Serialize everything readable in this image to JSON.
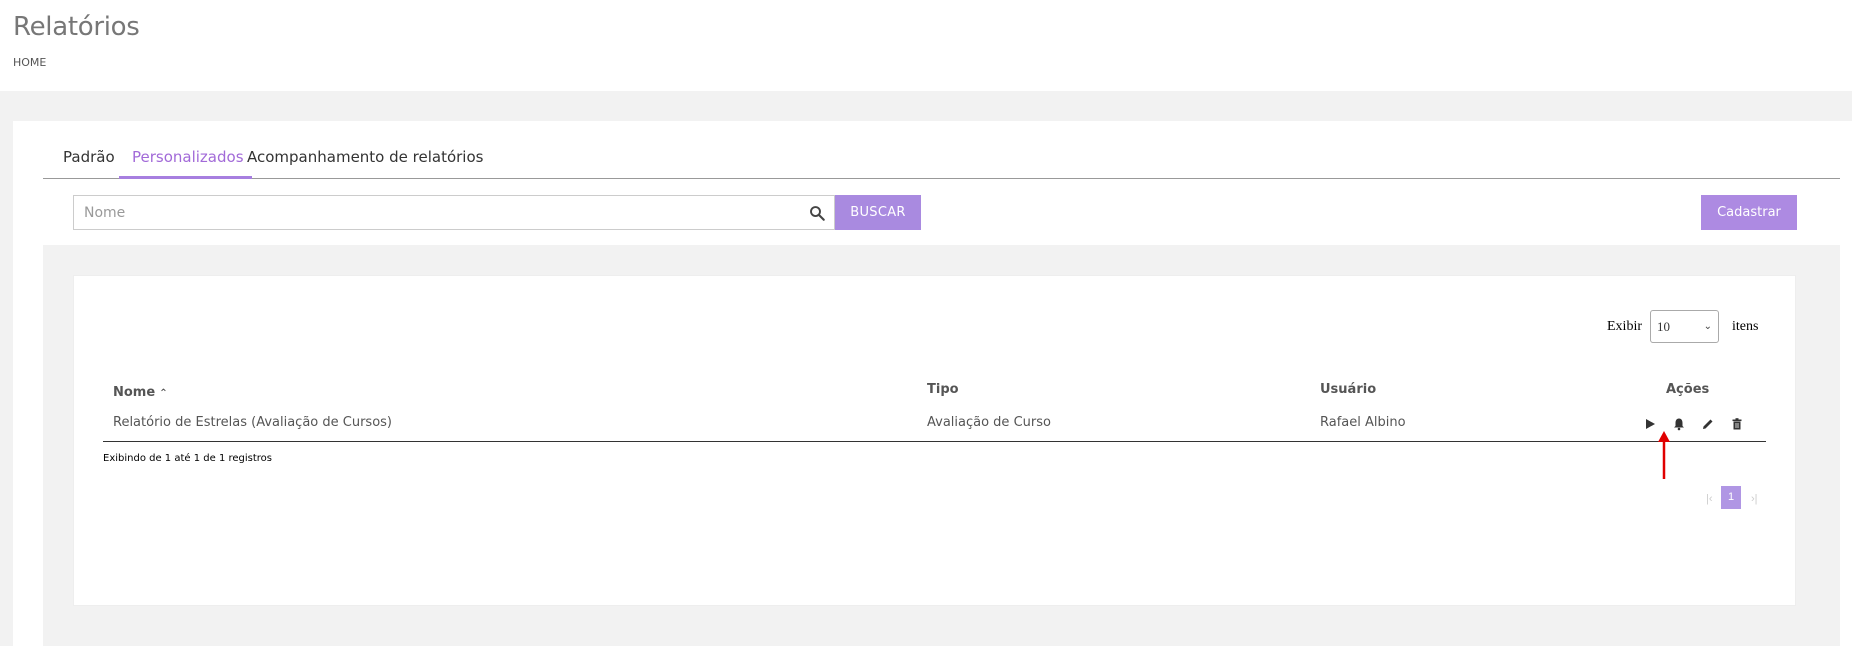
{
  "header": {
    "title": "Relatórios",
    "breadcrumb": "HOME"
  },
  "tabs": [
    {
      "label": "Padrão",
      "active": false
    },
    {
      "label": "Personalizados",
      "active": true
    },
    {
      "label": "Acompanhamento de relatórios",
      "active": false
    }
  ],
  "search": {
    "placeholder": "Nome",
    "value": "",
    "button_label": "BUSCAR"
  },
  "create_button_label": "Cadastrar",
  "pagination_size": {
    "prefix": "Exibir",
    "selected": "10",
    "suffix": "itens"
  },
  "table": {
    "columns": [
      "Nome",
      "Tipo",
      "Usuário",
      "Ações"
    ],
    "rows": [
      {
        "nome": "Relatório de Estrelas (Avaliação de Cursos)",
        "tipo": "Avaliação de Curso",
        "usuario": "Rafael Albino"
      }
    ],
    "actions": [
      "play-icon",
      "bell-icon",
      "pencil-icon",
      "trash-icon"
    ]
  },
  "records_info": "Exibindo de 1 até 1 de 1 registros",
  "pagination": {
    "current_page": "1",
    "first_icon": "first-page-icon",
    "last_icon": "last-page-icon"
  },
  "colors": {
    "accent": "#a77fe0",
    "button": "#ad8ae2",
    "annotation_arrow": "#e00000"
  }
}
